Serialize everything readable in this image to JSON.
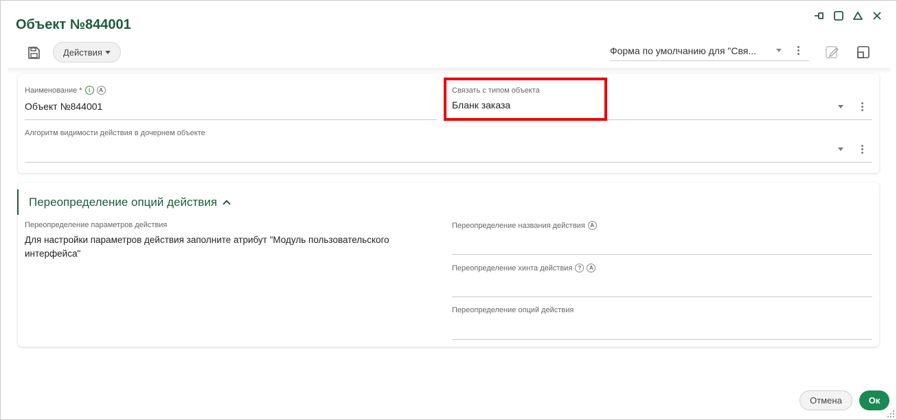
{
  "window": {
    "title": "Объект №844001"
  },
  "toolbar": {
    "actions_label": "Действия",
    "form_selector": "Форма по умолчанию для \"Свя..."
  },
  "main": {
    "name_field": {
      "label": "Наименование *",
      "info_icon": "info-icon",
      "auto_icon": "A",
      "value": "Объект №844001"
    },
    "link_type_field": {
      "label": "Связать с типом объекта",
      "value": "Бланк заказа"
    },
    "visibility_field": {
      "label": "Алгоритм видимости действия в дочернем объекте",
      "value": ""
    }
  },
  "override_section": {
    "title": "Переопределение опций действия",
    "params_label": "Переопределение параметров действия",
    "params_text": "Для настройки параметров действия заполните атрибут \"Модуль пользовательского интерфейса\"",
    "name_label": "Переопределение названия действия",
    "name_icon": "A",
    "hint_label": "Переопределение хинта действия",
    "hint_help_icon": "?",
    "hint_auto_icon": "A",
    "options_label": "Переопределение опций действия"
  },
  "footer": {
    "cancel_label": "Отмена",
    "ok_label": "Ок"
  },
  "colors": {
    "accent": "#1f5a3d",
    "ok_button": "#1a8a52",
    "highlight": "#ee0000"
  }
}
